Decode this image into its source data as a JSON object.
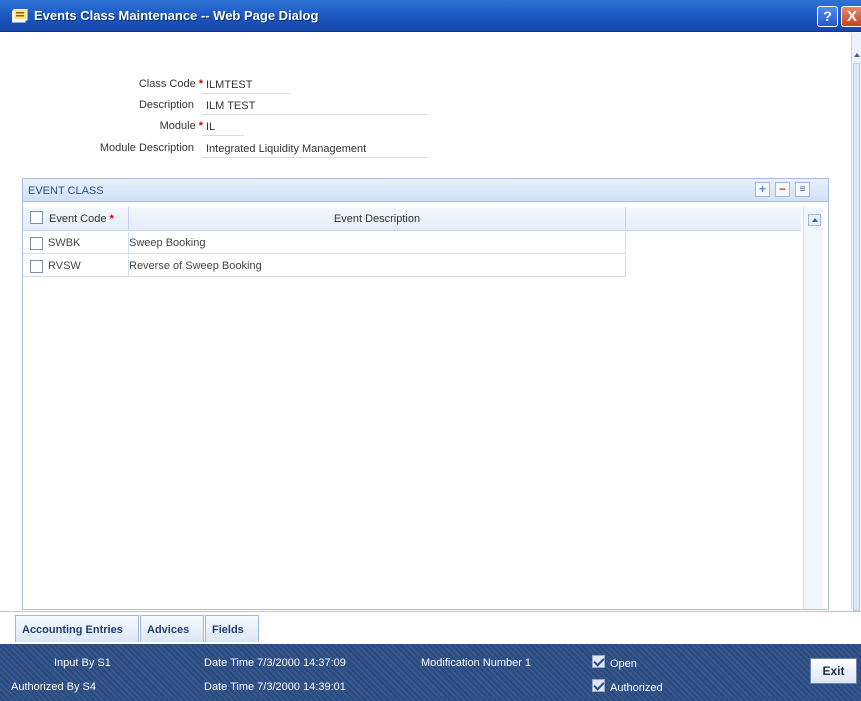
{
  "window": {
    "title": "Events Class Maintenance -- Web Page Dialog",
    "help_label": "?",
    "close_label": "X"
  },
  "form": {
    "class_code": {
      "label": "Class Code",
      "value": "ILMTEST",
      "required": "*"
    },
    "description": {
      "label": "Description",
      "value": "ILM TEST"
    },
    "module": {
      "label": "Module",
      "value": "IL",
      "required": "*"
    },
    "module_description": {
      "label": "Module Description",
      "value": "Integrated Liquidity Management"
    }
  },
  "event_class": {
    "title": "EVENT CLASS",
    "toolbar": {
      "add": "+",
      "delete": "−",
      "single_view": "≡"
    },
    "columns": {
      "event_code": "Event Code",
      "required": "*",
      "event_description": "Event Description"
    },
    "rows": [
      {
        "code": "SWBK",
        "description": "Sweep Booking"
      },
      {
        "code": "RVSW",
        "description": "Reverse of Sweep Booking"
      }
    ]
  },
  "tabs": [
    {
      "label": "Accounting Entries"
    },
    {
      "label": "Advices"
    },
    {
      "label": "Fields"
    }
  ],
  "footer": {
    "input_by": "Input By S1",
    "authorized_by": "Authorized By S4",
    "input_date_time": "Date Time 7/3/2000 14:37:09",
    "auth_date_time": "Date Time 7/3/2000 14:39:01",
    "modification_number": "Modification Number 1",
    "open_label": "Open",
    "authorized_label": "Authorized",
    "exit_label": "Exit"
  }
}
